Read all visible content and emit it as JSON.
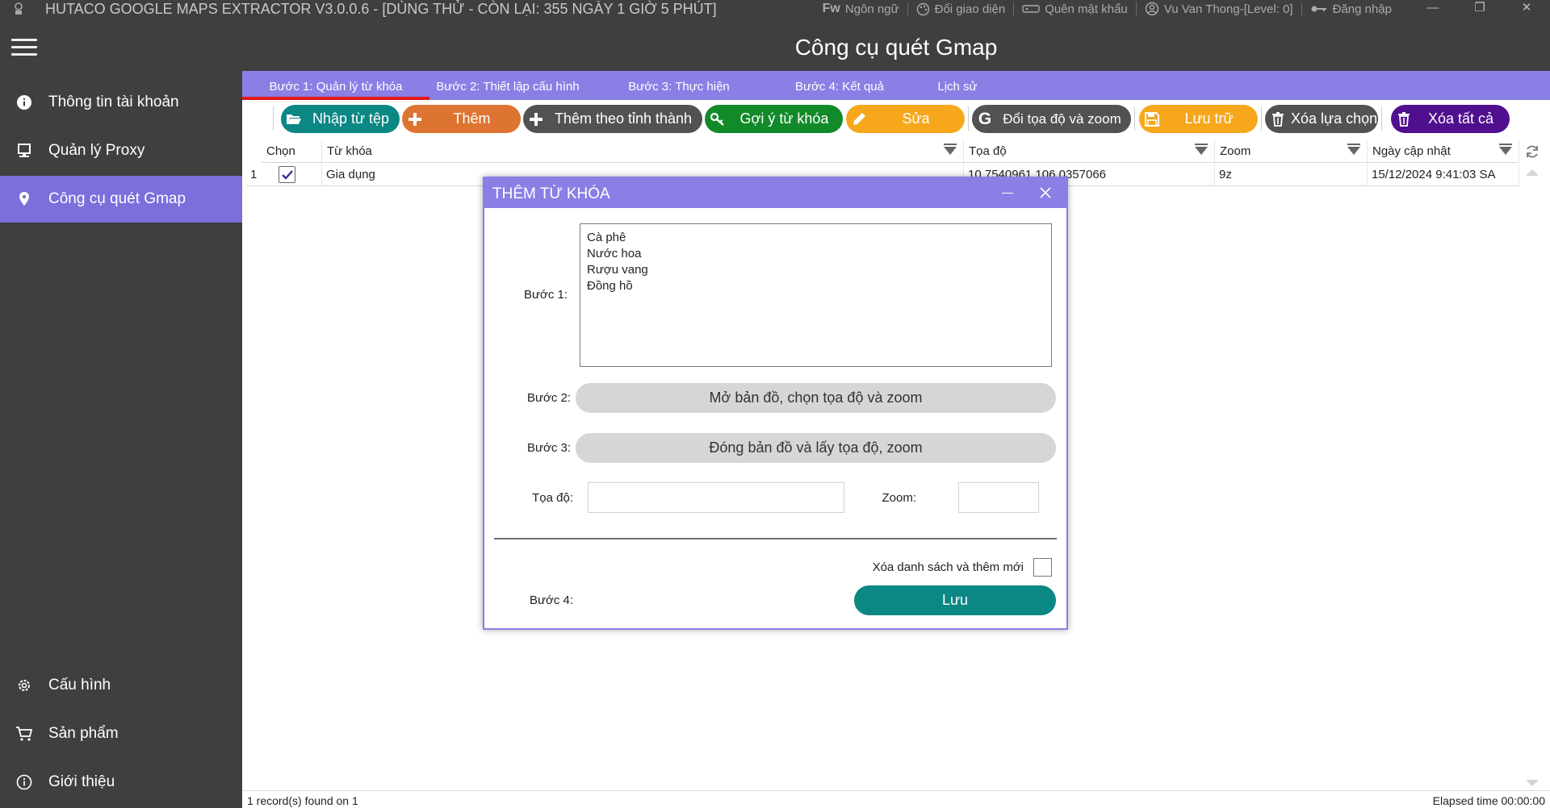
{
  "window": {
    "title": "HUTACO GOOGLE MAPS EXTRACTOR V3.0.0.6 - [DÙNG THỬ - CÒN LẠI: 355 NGÀY 1 GIỜ 5 PHÚT]",
    "links": {
      "language_prefix": "Fw",
      "language": "Ngôn ngữ",
      "theme": "Đổi giao diện",
      "forgot_password": "Quên mật khẩu",
      "user": "Vu Van Thong-[Level: 0]",
      "login": "Đăng nhập"
    }
  },
  "sidebar": {
    "items": [
      {
        "label": "Thông tin tài khoản",
        "icon": "info-circle-icon"
      },
      {
        "label": "Quản lý Proxy",
        "icon": "monitor-icon"
      },
      {
        "label": "Công cụ quét Gmap",
        "icon": "map-pin-icon"
      },
      {
        "label": "Cấu hình",
        "icon": "gear-icon"
      },
      {
        "label": "Sản phẩm",
        "icon": "cart-icon"
      },
      {
        "label": "Giới thiệu",
        "icon": "info-outline-icon"
      }
    ],
    "active_color": "#7a6fdb"
  },
  "header": {
    "title": "Công cụ quét Gmap"
  },
  "tabs": [
    {
      "label": "Bước 1: Quản lý từ khóa"
    },
    {
      "label": "Bước 2: Thiết lập cấu hình"
    },
    {
      "label": "Bước 3: Thực hiện"
    },
    {
      "label": "Bước 4: Kết quả"
    },
    {
      "label": "Lịch sử"
    }
  ],
  "toolbar": {
    "buttons": [
      {
        "label": "Nhập từ tệp",
        "color": "#0b8784",
        "icon": "folder-open-icon"
      },
      {
        "label": "Thêm",
        "color": "#de7431",
        "icon": "plus-icon"
      },
      {
        "label": "Thêm theo tỉnh thành",
        "color": "#525252",
        "icon": "plus-icon"
      },
      {
        "label": "Gợi ý từ khóa",
        "color": "#128a2a",
        "icon": "key-icon"
      },
      {
        "label": "Sửa",
        "color": "#f6a71b",
        "icon": "pencil-icon"
      },
      {
        "label": "Đổi tọa độ và zoom",
        "color": "#525252",
        "icon": "google-icon"
      },
      {
        "label": "Lưu trữ",
        "color": "#f6a71b",
        "icon": "floppy-icon"
      },
      {
        "label": "Xóa lựa chọn",
        "color": "#525252",
        "icon": "trash-icon"
      },
      {
        "label": "Xóa tất cả",
        "color": "#4f0f8f",
        "icon": "trash-icon"
      }
    ]
  },
  "grid": {
    "columns": [
      "Chọn",
      "Từ khóa",
      "Tọa độ",
      "Zoom",
      "Ngày cập nhật"
    ],
    "rows": [
      {
        "index": "1",
        "checked": true,
        "keyword": "Gia dụng",
        "coords": "10.7540961,106.0357066",
        "zoom": "9z",
        "updated": "15/12/2024 9:41:03 SA"
      }
    ]
  },
  "status": {
    "records": "1 record(s) found on 1",
    "elapsed": "Elapsed time 00:00:00"
  },
  "dialog": {
    "title": "THÊM TỪ KHÓA",
    "step1_label": "Bước 1:",
    "keywords_text": "Cà phê\nNước hoa\nRượu vang\nĐồng hồ",
    "step2_label": "Bước 2:",
    "open_map_button": "Mở bản đồ, chọn tọa độ và zoom",
    "step3_label": "Bước 3:",
    "close_map_button": "Đóng bản đồ và lấy tọa độ, zoom",
    "coords_label": "Tọa độ:",
    "coords_value": "",
    "zoom_label": "Zoom:",
    "zoom_value": "",
    "clear_label": "Xóa danh sách và thêm mới",
    "step4_label": "Bước 4:",
    "save_button": "Lưu"
  }
}
